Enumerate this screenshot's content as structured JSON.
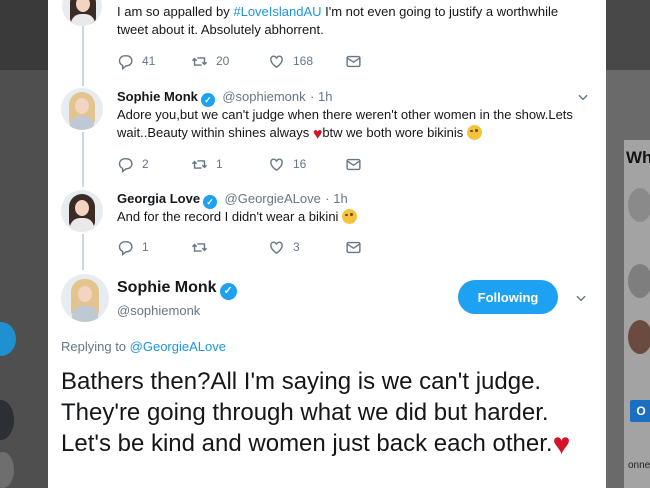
{
  "prev_tweet": {
    "text_prefix": "I am so appalled by ",
    "hashtag": "#LoveIslandAU",
    "text_suffix": " I'm not even going to justify a worthwhile tweet about it. Absolutely abhorrent.",
    "replies": "41",
    "retweets": "20",
    "likes": "168"
  },
  "reply1": {
    "name": "Sophie Monk",
    "handle": "@sophiemonk",
    "time": "· 1h",
    "text_a": "Adore you,but we can't judge when there weren't other women in the show.Lets wait..Beauty within shines always ",
    "text_b": "btw we both wore bikinis",
    "replies": "2",
    "retweets": "1",
    "likes": "16"
  },
  "reply2": {
    "name": "Georgia Love",
    "handle": "@GeorgieALove",
    "time": "· 1h",
    "text": "And for the record I didn't wear a bikini",
    "replies": "1",
    "retweets": "",
    "likes": "3"
  },
  "main_tweet": {
    "name": "Sophie Monk",
    "handle": "@sophiemonk",
    "follow_label": "Following",
    "replying_label": "Replying to ",
    "replying_to": "@GeorgieALove",
    "text": "Bathers then?All I'm saying is we can't judge. They're going through what we did but harder. Let's be kind and women just back each other."
  },
  "sidebar": {
    "heading": "Who",
    "app_icon_letter": "O",
    "snippet": "onne"
  },
  "colors": {
    "accent": "#1da1f2",
    "link": "#1b95e0",
    "heart": "#d4132a",
    "muted": "#657786"
  }
}
